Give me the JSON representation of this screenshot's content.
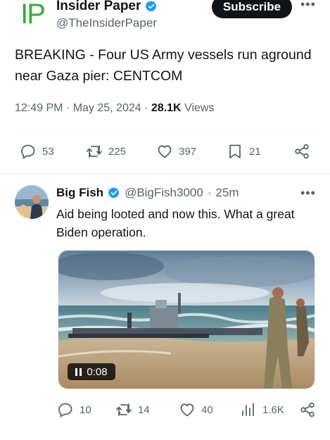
{
  "main_tweet": {
    "author_name": "Insider Paper",
    "author_handle": "@TheInsiderPaper",
    "logo_text": "IP",
    "subscribe_label": "Subscribe",
    "text": "BREAKING - Four US Army vessels run aground near Gaza pier: CENTCOM",
    "time": "12:49 PM",
    "date": "May 25, 2024",
    "views_count": "28.1K",
    "views_label": "Views",
    "actions": {
      "replies": "53",
      "reposts": "225",
      "likes": "397",
      "bookmarks": "21"
    }
  },
  "reply_tweet": {
    "author_name": "Big Fish",
    "author_handle": "@BigFish3000",
    "time_ago": "25m",
    "text": "Aid being looted and now this. What a great Biden operation.",
    "video_time": "0:08",
    "actions": {
      "replies": "10",
      "reposts": "14",
      "likes": "40",
      "views": "1.6K"
    }
  },
  "icons": {
    "verified": "verified-badge-icon",
    "more": "more-horizontal-icon",
    "reply": "reply-icon",
    "repost": "repost-icon",
    "like": "heart-icon",
    "bookmark": "bookmark-icon",
    "share": "share-icon",
    "views": "views-icon",
    "pause": "pause-icon"
  },
  "colors": {
    "brand_green": "#2fae3a",
    "verified_blue": "#1d9bf0",
    "text_primary": "#0f1419",
    "text_secondary": "#536471",
    "divider": "#eff3f4"
  }
}
